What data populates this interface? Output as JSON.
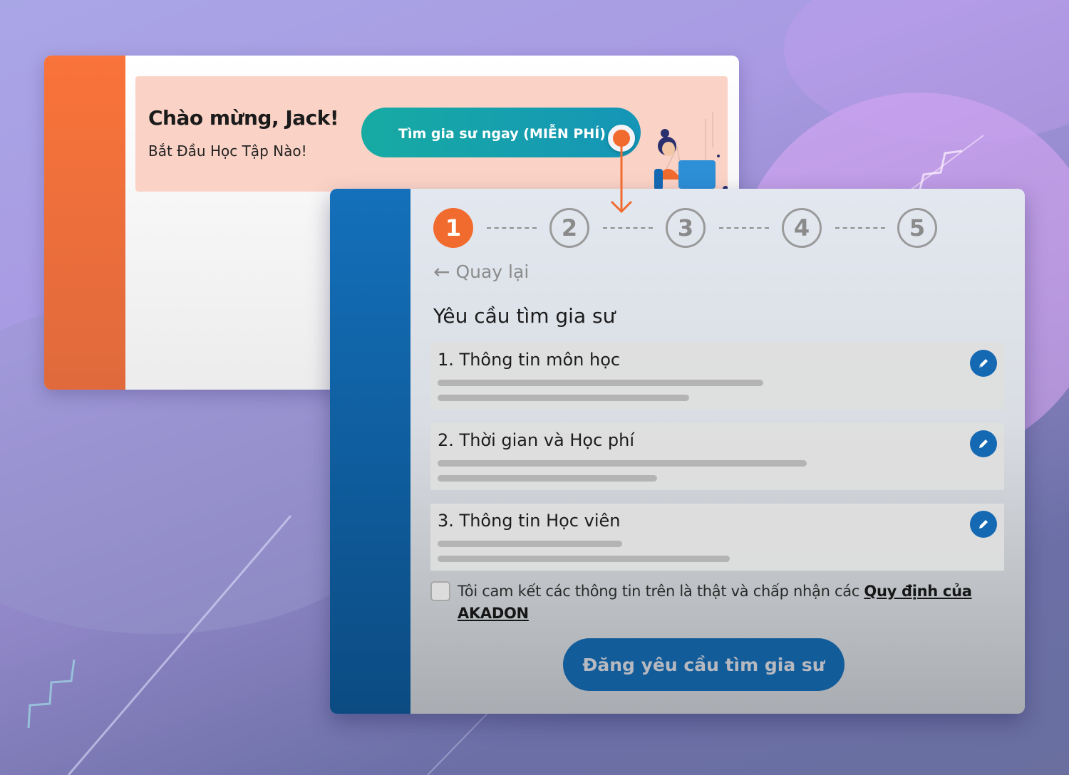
{
  "welcome": {
    "title": "Chào mừng, Jack!",
    "subtitle": "Bắt Đầu Học Tập Nào!",
    "cta_label": "Tìm gia sư ngay (MIỄN PHÍ)"
  },
  "stepper": {
    "steps": [
      "1",
      "2",
      "3",
      "4",
      "5"
    ],
    "active_step": "1"
  },
  "form": {
    "back_label": "Quay lại",
    "title": "Yêu cầu tìm gia sư",
    "sections": [
      {
        "title": "1. Thông tin môn học"
      },
      {
        "title": "2. Thời gian và Học phí"
      },
      {
        "title": "3. Thông tin Học viên"
      }
    ],
    "commitment_text": "Tôi cam kết các thông tin trên là thật và chấp nhận các ",
    "commitment_link": "Quy định của AKADON",
    "submit_label": "Đăng yêu cầu tìm gia sư"
  },
  "colors": {
    "orange_accent": "#f26b2e",
    "teal_button": "#17aba3",
    "primary_blue": "#1569b3",
    "welcome_banner": "#fbd3c6"
  },
  "icons": {
    "back": "arrow-left-icon",
    "edit": "pencil-icon"
  }
}
